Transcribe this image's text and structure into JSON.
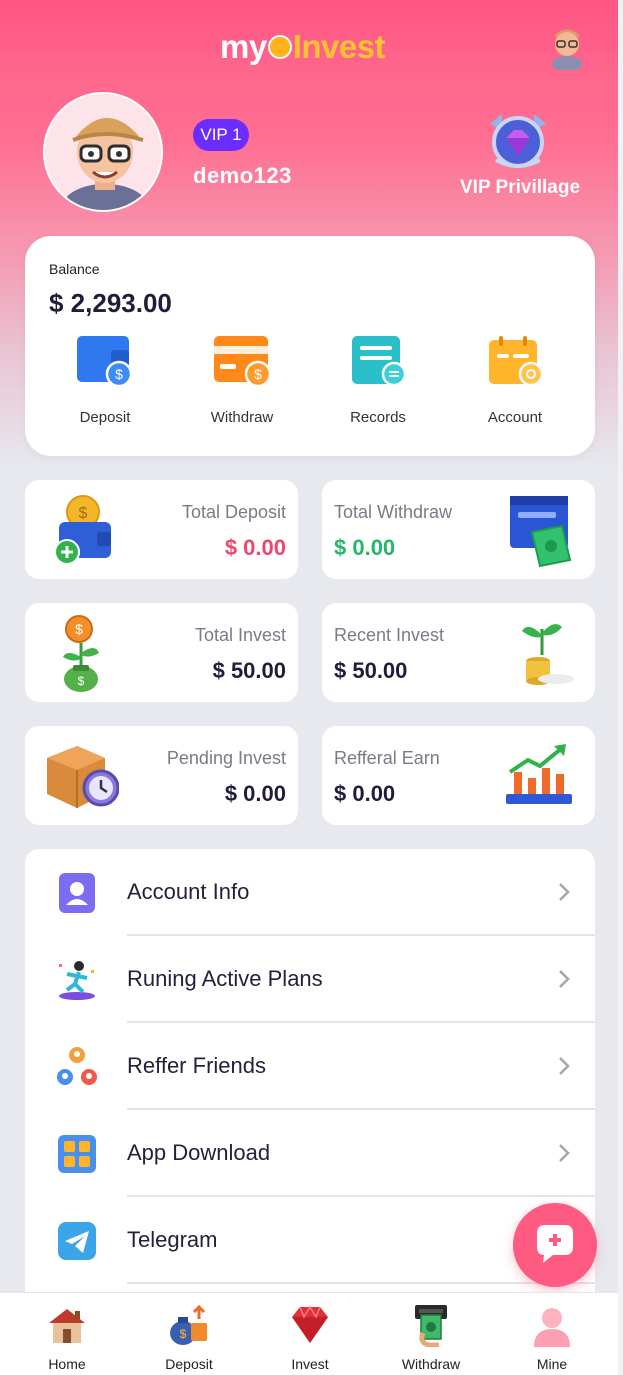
{
  "header": {
    "logo_part1": "my",
    "logo_part2": "Invest"
  },
  "profile": {
    "vip_level": "VIP 1",
    "username": "demo123",
    "vip_privilege_label": "VIP Privillage"
  },
  "balance": {
    "label": "Balance",
    "amount": "$ 2,293.00",
    "actions": [
      {
        "label": "Deposit",
        "icon": "wallet-icon"
      },
      {
        "label": "Withdraw",
        "icon": "card-icon"
      },
      {
        "label": "Records",
        "icon": "records-icon"
      },
      {
        "label": "Account",
        "icon": "calendar-icon"
      }
    ]
  },
  "stats": {
    "total_deposit": {
      "title": "Total Deposit",
      "value": "$ 0.00"
    },
    "total_withdraw": {
      "title": "Total Withdraw",
      "value": "$ 0.00"
    },
    "total_invest": {
      "title": "Total Invest",
      "value": "$ 50.00"
    },
    "recent_invest": {
      "title": "Recent Invest",
      "value": "$ 50.00"
    },
    "pending_invest": {
      "title": "Pending Invest",
      "value": "$ 0.00"
    },
    "refferal_earn": {
      "title": "Refferal Earn",
      "value": "$ 0.00"
    }
  },
  "menu": [
    {
      "label": "Account Info",
      "icon": "user-icon"
    },
    {
      "label": "Runing Active Plans",
      "icon": "runner-icon"
    },
    {
      "label": "Reffer Friends",
      "icon": "friends-icon"
    },
    {
      "label": "App Download",
      "icon": "grid-icon"
    },
    {
      "label": "Telegram",
      "icon": "telegram-icon"
    }
  ],
  "bottom_nav": [
    {
      "label": "Home",
      "icon": "house-icon"
    },
    {
      "label": "Deposit",
      "icon": "money-bag-icon"
    },
    {
      "label": "Invest",
      "icon": "ruby-icon"
    },
    {
      "label": "Withdraw",
      "icon": "atm-icon"
    },
    {
      "label": "Mine",
      "icon": "person-icon"
    }
  ],
  "colors": {
    "brand_pink": "#ff5a82",
    "logo_yellow": "#ffc233",
    "vip_purple": "#6b2cff",
    "deposit_red": "#f0466e",
    "withdraw_green": "#22b866"
  }
}
